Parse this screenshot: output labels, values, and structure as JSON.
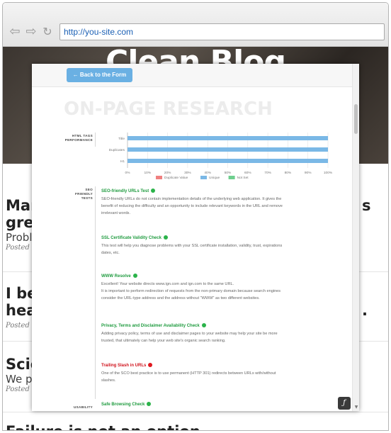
{
  "browser": {
    "url": "http://you-site.com",
    "back_glyph": "⇦",
    "forward_glyph": "⇨",
    "reload_glyph": "↻"
  },
  "blog": {
    "site_title": "Clean Blog",
    "posts": [
      {
        "title_line1": "Man",
        "title_line1_tail": "s",
        "title_line2": "grea",
        "subtitle": "Proble",
        "meta": "Posted b"
      },
      {
        "title_line1": "I bel",
        "title_line1_tail": "",
        "title_line2": "hea",
        "title_line2_tail": ".",
        "subtitle": "",
        "meta": "Posted b"
      },
      {
        "title_line1": "Scie",
        "subtitle": "We pre",
        "meta": "Posted b"
      },
      {
        "title_line1": "Failure is not an option",
        "subtitle": "",
        "meta": ""
      }
    ]
  },
  "modal": {
    "back_button_label": "← Back to the Form",
    "heading": "ON-PAGE RESEARCH",
    "chart_side_label_1": "HTML TAGS",
    "chart_side_label_2": "PERFORMANCE",
    "seo_side_label_1": "SEO",
    "seo_side_label_2": "FRIENDLY",
    "seo_side_label_3": "TESTS",
    "usability_side_label": "USABILITY",
    "fab_glyph": "ƒ",
    "checks": [
      {
        "title": "SEO-friendly URLs Test",
        "status": "good",
        "lines": [
          "SEO-friendly URLs do not contain implementation details of the underlying web application. It gives the",
          "benefit of reducing the difficulty and an opportunity to include relevant keywords in the URL and remove",
          "irrelevant words."
        ]
      },
      {
        "title": "SSL Certificate Validity Check",
        "status": "good",
        "lines": [
          "This test will help you diagnose problems with your SSL certificate installation, validity, trust, expirations",
          "dates, etc."
        ]
      },
      {
        "title": "WWW Resolve",
        "status": "good",
        "lines": [
          "Excellent! Your website directs www.ign.com and ign.com to the same URL.",
          "It is important to perform redirection of requests from the non-primary domain because search engines",
          "consider the URL-type address and the address without \"WWW\" as two different websites."
        ]
      },
      {
        "title": "Privacy, Terms and Disclaimer Availability Check",
        "status": "good",
        "lines": [
          "Adding privacy policy, terms of use and disclaimer pages to your website may help your site be more",
          "trusted, that ultimately can help your web site's organic search ranking."
        ]
      },
      {
        "title": "Trailing Slash in URLs",
        "status": "bad",
        "lines": [
          "One of the SCO best practice is to use permanent (HTTP 301) redirects between URLs with/without",
          "slashes."
        ]
      },
      {
        "title": "Safe Browsing Check",
        "status": "good",
        "lines": []
      }
    ]
  },
  "chart_data": {
    "type": "bar",
    "orientation": "horizontal",
    "stacked": true,
    "categories": [
      "Title",
      "Duplicates",
      "H1"
    ],
    "series": [
      {
        "name": "Duplicate Value",
        "color": "#f08080",
        "values": [
          0,
          0,
          0
        ]
      },
      {
        "name": "Unique",
        "color": "#7ab8e6",
        "values": [
          100,
          100,
          100
        ]
      },
      {
        "name": "Not Set",
        "color": "#6ecf8e",
        "values": [
          0,
          0,
          0
        ]
      }
    ],
    "xticks": [
      "0%",
      "10%",
      "20%",
      "30%",
      "40%",
      "50%",
      "60%",
      "70%",
      "80%",
      "90%",
      "100%"
    ],
    "xlim": [
      0,
      100
    ],
    "legend_position": "bottom",
    "grid": true
  }
}
